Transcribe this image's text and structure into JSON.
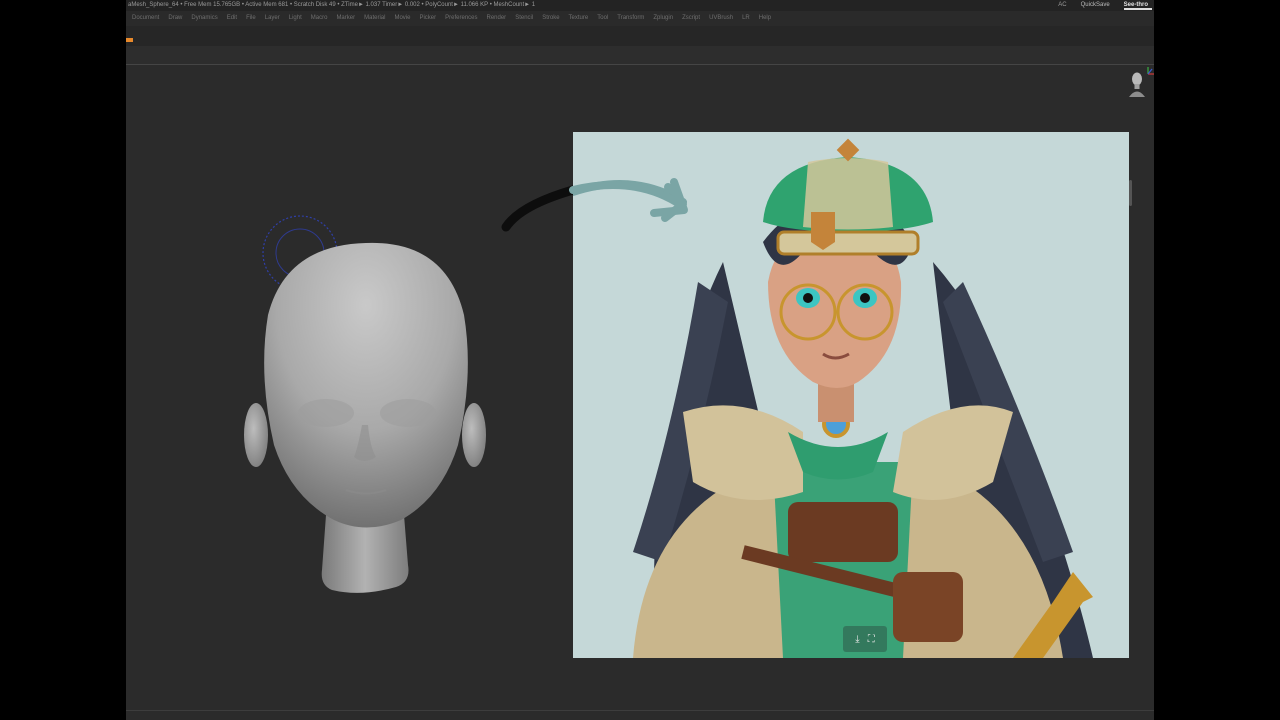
{
  "status_bar": {
    "text": "aMesh_Sphere_64   • Free Mem 15.765GB • Active Mem 681 • Scratch Disk 49 •  ZTime► 1.037 Timer► 0.002 • PolyCount► 11.066 KP  • MeshCount► 1",
    "quicksave": "QuickSave",
    "see_through": "See-thro",
    "small_label": "AC"
  },
  "menu": {
    "items": [
      "Document",
      "Draw",
      "Dynamics",
      "Edit",
      "File",
      "Layer",
      "Light",
      "Macro",
      "Marker",
      "Material",
      "Movie",
      "Picker",
      "Preferences",
      "Render",
      "Stencil",
      "Stroke",
      "Texture",
      "Tool",
      "Transform",
      "Zplugin",
      "Zscript",
      "UVBrush",
      "LR",
      "Help"
    ]
  },
  "reference_controls": {
    "download_icon": "download-icon",
    "fullscreen_icon": "fullscreen-icon"
  },
  "colors": {
    "app_bg": "#2b2b2b",
    "accent": "#e8892b",
    "reference_bg": "#c5d8d8",
    "brush_cursor": "#2f3fa8"
  }
}
